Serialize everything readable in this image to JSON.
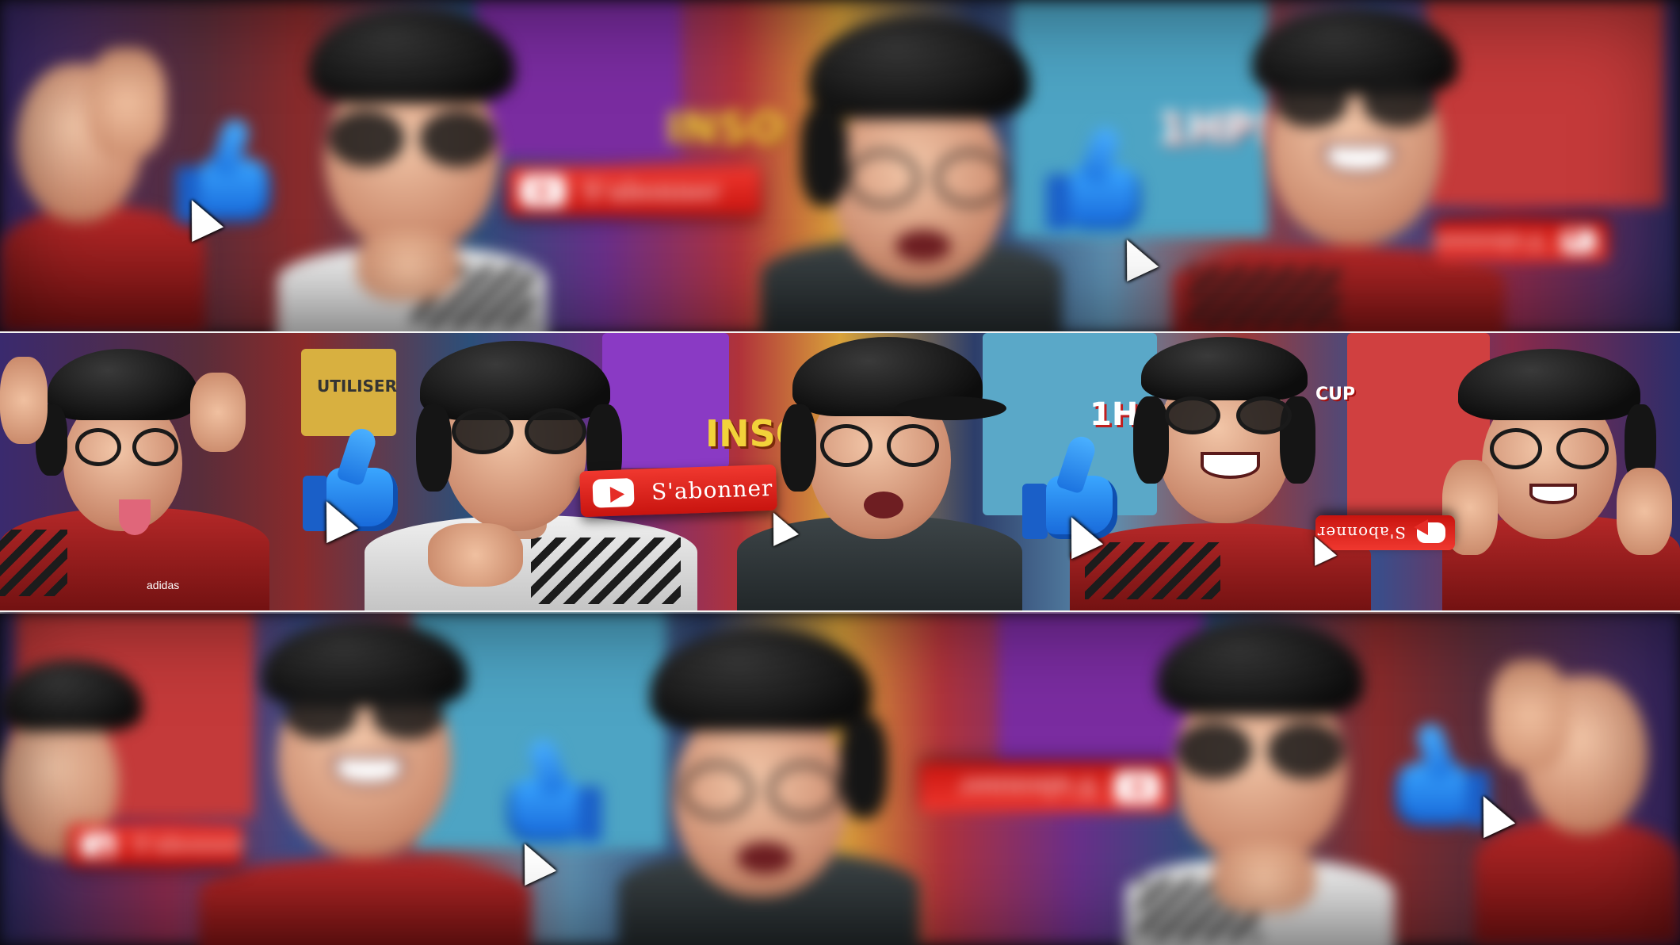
{
  "banner": {
    "subscribe_label": "S'abonner",
    "poster_word_1": "INSO",
    "poster_word_2": "1HP!",
    "poster_word_3": "UTILISER",
    "poster_word_4": "CUP",
    "brand_text": "adidas"
  },
  "colors": {
    "subscribe_red": "#e52d27",
    "like_blue": "#1c74e0"
  },
  "icons": [
    "youtube-play-icon",
    "thumbs-up-icon",
    "mouse-cursor-icon"
  ]
}
